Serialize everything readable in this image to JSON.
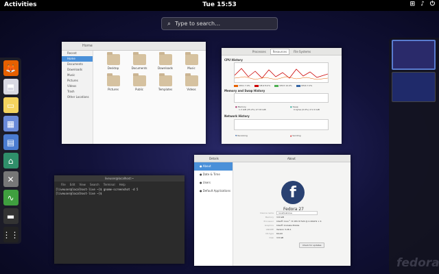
{
  "topbar": {
    "activities": "Activities",
    "clock": "Tue 15:53",
    "tray_icons": [
      "network-icon",
      "volume-icon",
      "power-icon"
    ]
  },
  "search": {
    "placeholder": "Type to search…"
  },
  "dock": {
    "items": [
      {
        "name": "firefox-icon",
        "glyph": "🦊",
        "bg": "#e66000"
      },
      {
        "name": "boxes-icon",
        "glyph": "⬒",
        "bg": "#d9d9e3"
      },
      {
        "name": "files-icon",
        "glyph": "▭",
        "bg": "#f4d35e"
      },
      {
        "name": "screenshot-icon",
        "glyph": "▦",
        "bg": "#6a8ad9"
      },
      {
        "name": "disks-icon",
        "glyph": "▤",
        "bg": "#4a7bd0"
      },
      {
        "name": "system-icon",
        "glyph": "⌂",
        "bg": "#2f8f6a"
      },
      {
        "name": "tools-icon",
        "glyph": "✕",
        "bg": "#777"
      },
      {
        "name": "system-monitor-icon",
        "glyph": "∿",
        "bg": "#3f9f3f"
      },
      {
        "name": "terminal-icon",
        "glyph": "▬",
        "bg": "#333"
      },
      {
        "name": "app-grid-icon",
        "glyph": "⋮⋮",
        "bg": "#222"
      }
    ]
  },
  "files": {
    "title": "Home",
    "sidebar": [
      "Recent",
      "Home",
      "Documents",
      "Downloads",
      "Music",
      "Pictures",
      "Videos",
      "Trash",
      "Other Locations"
    ],
    "folders": [
      "Desktop",
      "Documents",
      "Downloads",
      "Music",
      "Pictures",
      "Public",
      "Templates",
      "Videos"
    ]
  },
  "sysmon": {
    "tabs": [
      "Processes",
      "Resources",
      "File Systems"
    ],
    "cpu": "CPU History",
    "mem": "Memory and Swap History",
    "net": "Network History",
    "cpu_legend": [
      "CPU1 7.0%",
      "CPU2 8.0%",
      "CPU3 10.0%",
      "CPU4 7.0%"
    ],
    "cpu_colors": [
      "#e66000",
      "#cc0000",
      "#4caf50",
      "#3465a4"
    ],
    "mem_label": "Memory",
    "swap_label": "Swap",
    "mem_detail": "1.3 GiB (35.2%) of 3.8 GiB",
    "swap_detail": "0 bytes (0.0%) of 2.0 GiB",
    "recv": "Receiving",
    "sent": "Sending"
  },
  "terminal": {
    "title": "liveuser@localhost:~",
    "menu": [
      "File",
      "Edit",
      "View",
      "Search",
      "Terminal",
      "Help"
    ],
    "lines": [
      "[liveuser@localhost-live ~]$ gnome-screenshot -d 5",
      "[liveuser@localhost-live ~]$ "
    ]
  },
  "settings": {
    "left_title": "Details",
    "right_title": "About",
    "sidebar": [
      "About",
      "Date & Time",
      "Users",
      "Default Applications"
    ],
    "version": "Fedora 27",
    "rows": [
      {
        "k": "Device name",
        "v": "localhost-live"
      },
      {
        "k": "Memory",
        "v": "3.8 GiB"
      },
      {
        "k": "Processor",
        "v": "Intel® Core™ i5 CPU M 520 @ 2.40GHz × 4"
      },
      {
        "k": "Graphics",
        "v": "Intel® Ironlake Mobile"
      },
      {
        "k": "GNOME",
        "v": "Version 3.26.1"
      },
      {
        "k": "OS type",
        "v": "64-bit"
      },
      {
        "k": "Disk",
        "v": "3.8 GB"
      }
    ],
    "update_button": "Check for updates"
  },
  "watermark": "fedora"
}
